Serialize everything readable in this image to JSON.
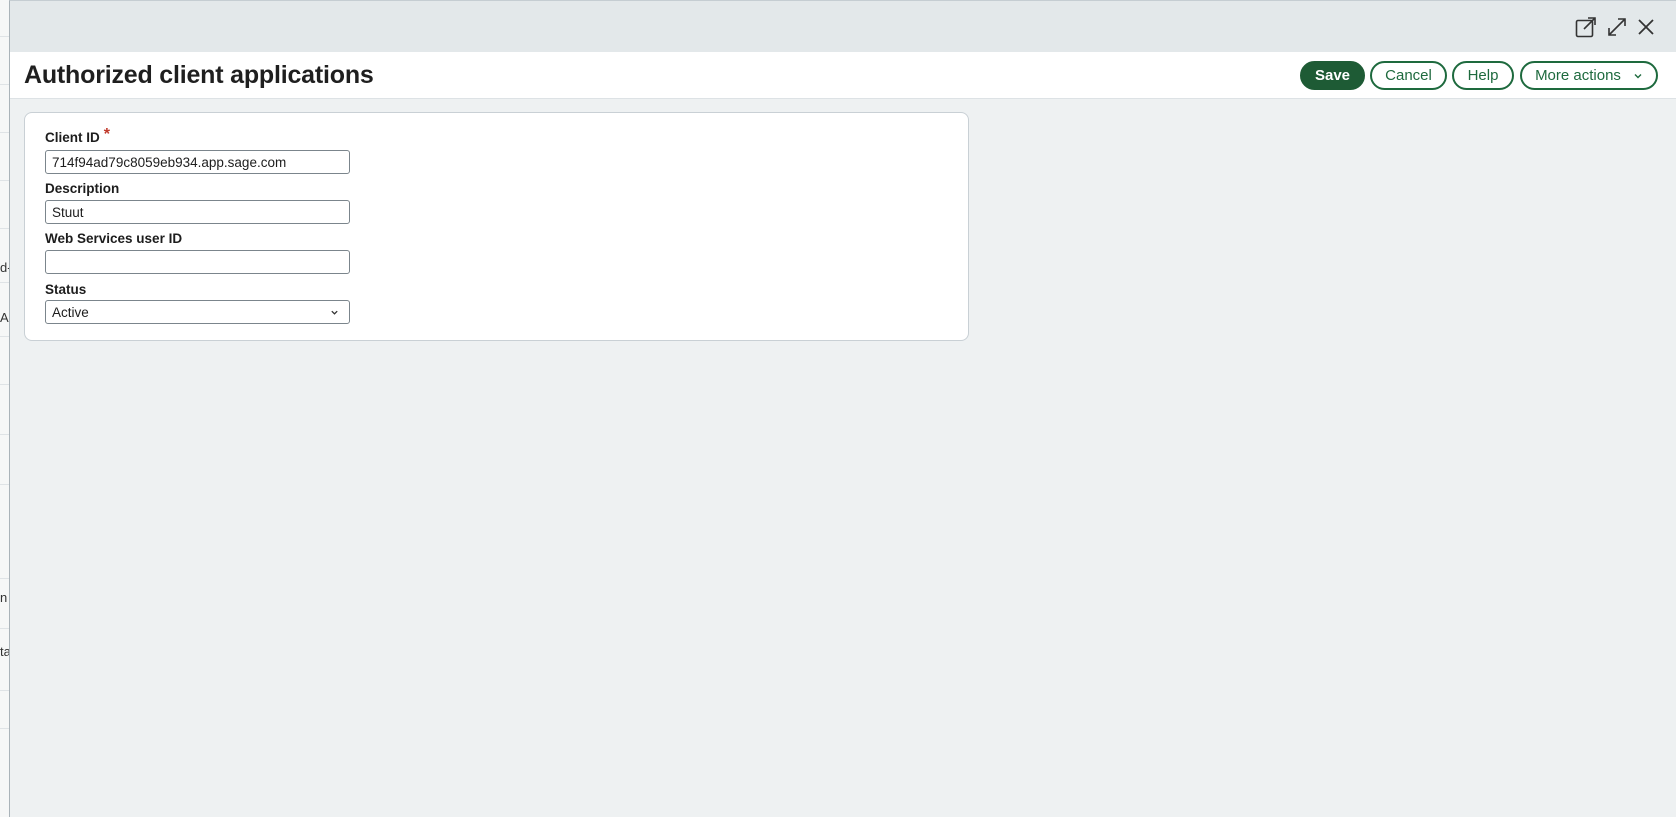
{
  "background": {
    "fragments": [
      "d-",
      "A",
      "n",
      "ta"
    ]
  },
  "window_controls": {
    "open_new": "open-in-new-window-icon",
    "expand": "expand-icon",
    "close": "close-icon"
  },
  "header": {
    "title": "Authorized client applications",
    "buttons": {
      "save": "Save",
      "cancel": "Cancel",
      "help": "Help",
      "more_actions": "More actions"
    }
  },
  "form": {
    "client_id": {
      "label": "Client ID",
      "required_mark": "*",
      "value": "714f94ad79c8059eb934.app.sage.com"
    },
    "description": {
      "label": "Description",
      "value": "Stuut"
    },
    "web_services_user_id": {
      "label": "Web Services user ID",
      "value": ""
    },
    "status": {
      "label": "Status",
      "value": "Active"
    }
  },
  "colors": {
    "accent": "#1e5b35",
    "required": "#c0392b",
    "modal_bg": "#eef1f2",
    "topbar_bg": "#e3e8ea"
  }
}
